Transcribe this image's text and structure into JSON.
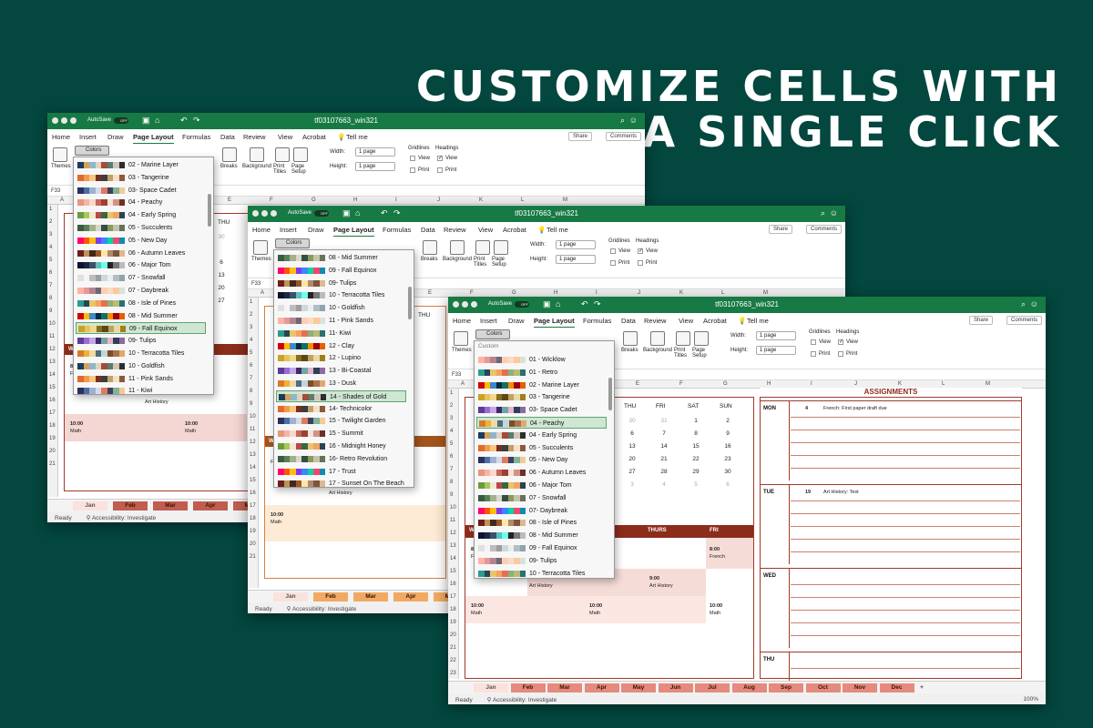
{
  "headline": {
    "line1": "CUSTOMIZE CELLS WITH",
    "line2": "A SINGLE CLICK"
  },
  "app": {
    "autosave": "AutoSave",
    "toggle": "OFF",
    "filename": "tf03107663_win321",
    "menu": [
      "Home",
      "Insert",
      "Draw",
      "Page Layout",
      "Formulas",
      "Data",
      "Review",
      "View",
      "Acrobat"
    ],
    "tell_me": "Tell me",
    "share": "Share",
    "comments": "Comments",
    "ribbon": {
      "themes": "Themes",
      "colors": "Colors",
      "breaks": "Breaks",
      "background": "Background",
      "print_titles": "Print Titles",
      "page_setup": "Page Setup",
      "width_label": "Width:",
      "height_label": "Height:",
      "width_value": "1 page",
      "height_value": "1 page",
      "gridlines": "Gridlines",
      "headings": "Headings",
      "view": "View",
      "print": "Print"
    },
    "status_ready": "Ready",
    "status_access": "Accessibility: Investigate",
    "zoom": "100%"
  },
  "window1": {
    "cell_ref": "F33",
    "columns": [
      "A",
      "B",
      "C",
      "D",
      "E",
      "F",
      "G",
      "H",
      "I",
      "J",
      "K",
      "L",
      "M"
    ],
    "rows": [
      "1",
      "2",
      "3",
      "4",
      "5",
      "6",
      "7",
      "8",
      "9",
      "10",
      "11",
      "12",
      "13",
      "14",
      "15",
      "16",
      "17",
      "18",
      "19",
      "20",
      "21"
    ],
    "dropdown": [
      "02 - Marine Layer",
      "03 - Tangerine",
      "03- Space Cadet",
      "04 - Peachy",
      "04 - Early Spring",
      "05 - Succulents",
      "05 - New Day",
      "06 - Autumn Leaves",
      "06 - Major Tom",
      "07 - Snowfall",
      "07 - Daybreak",
      "08 - Isle of Pines",
      "08 - Mid Summer",
      "09 - Fall Equinox",
      "09- Tulips",
      "10 - Terracotta Tiles",
      "10 - Goldfish",
      "11 - Pink Sands",
      "11 - Kiwi"
    ],
    "selected": "09 - Fall Equinox",
    "peek": {
      "thu": "THU",
      "n30": "30",
      "n6": "6",
      "n13": "13",
      "n20": "20",
      "n27": "27",
      "we": "WE",
      "t8": "8:",
      "fr": "Fr"
    },
    "cells": {
      "art": "Art History",
      "t10a": "10:00",
      "math": "Math",
      "t10b": "10:00",
      "math2": "Math"
    },
    "tabs": [
      "Jan",
      "Feb",
      "Mar",
      "Apr",
      "May"
    ]
  },
  "window2": {
    "cell_ref": "F33",
    "columns": [
      "A",
      "B",
      "C",
      "D",
      "E",
      "F",
      "G",
      "H",
      "I",
      "J",
      "K",
      "L",
      "M"
    ],
    "rows": [
      "1",
      "2",
      "3",
      "4",
      "5",
      "6",
      "7",
      "8",
      "9",
      "10",
      "11",
      "12",
      "13",
      "14",
      "15",
      "16",
      "17",
      "18",
      "19",
      "20",
      "21"
    ],
    "dropdown": [
      "08 - Mid Summer",
      "09 - Fall Equinox",
      "09- Tulips",
      "10 - Terracotta Tiles",
      "10 - Goldfish",
      "11 - Pink Sands",
      "11- Kiwi",
      "12 - Clay",
      "12 - Lupino",
      "13 - Bi-Coastal",
      "13 - Dusk",
      "14 - Shades of Gold",
      "14- Technicolor",
      "15 - Twilight Garden",
      "15 - Summit",
      "16 - Midnight Honey",
      "16- Retro Revolution",
      "17 - Trust",
      "17 - Sunset On The Beach"
    ],
    "selected": "14 - Shades of Gold",
    "peek": {
      "thu": "THU",
      "we": "WE",
      "fr": "Fr"
    },
    "cells": {
      "art": "Art History",
      "t10": "10:00",
      "math": "Math"
    },
    "tabs": [
      "Jan",
      "Feb",
      "Mar",
      "Apr",
      "May"
    ]
  },
  "window3": {
    "cell_ref": "F33",
    "columns": [
      "A",
      "B",
      "C",
      "D",
      "E",
      "F",
      "G",
      "H",
      "I",
      "J",
      "K",
      "L",
      "M"
    ],
    "rows": [
      "1",
      "2",
      "3",
      "4",
      "5",
      "6",
      "7",
      "8",
      "9",
      "10",
      "11",
      "12",
      "13",
      "14",
      "15",
      "16",
      "17",
      "18",
      "19",
      "20",
      "21",
      "22",
      "23",
      "24"
    ],
    "dropdown_header": "Custom",
    "dropdown": [
      "01 - Wicklow",
      "01 - Retro",
      "02 - Marine Layer",
      "03 - Tangerine",
      "03- Space Cadet",
      "04 - Peachy",
      "04 - Early Spring",
      "05 - Succulents",
      "05 - New Day",
      "06 - Autumn Leaves",
      "06 - Major Tom",
      "07 - Snowfall",
      "07- Daybreak",
      "08 - Isle of Pines",
      "08 - Mid Summer",
      "09 - Fall Equinox",
      "09- Tulips",
      "10 - Terracotta Tiles"
    ],
    "selected": "04 - Peachy",
    "calendar": {
      "headers": [
        "THU",
        "FRI",
        "SAT",
        "SUN"
      ],
      "weeks": [
        [
          "30",
          "31",
          "1",
          "2"
        ],
        [
          "6",
          "7",
          "8",
          "9"
        ],
        [
          "13",
          "14",
          "15",
          "16"
        ],
        [
          "20",
          "21",
          "22",
          "23"
        ],
        [
          "27",
          "28",
          "29",
          "30"
        ],
        [
          "3",
          "4",
          "5",
          "6"
        ]
      ]
    },
    "week_header": [
      "THURS",
      "FRI"
    ],
    "we": "WE",
    "cells": {
      "t8_left": "8:",
      "fr_left": "Fr",
      "t8": "8:00",
      "french": "French",
      "t9": "9:00",
      "art_hist": "Art History",
      "art_hist2": "Art History",
      "t10a": "10:00",
      "math_a": "Math",
      "t10b": "10:00",
      "math_b": "Math",
      "t10c": "10:00",
      "math_c": "Math"
    },
    "assignments": {
      "title": "ASSIGNMENTS",
      "days": [
        "MON",
        "TUE",
        "WED",
        "THU"
      ],
      "entries": [
        {
          "num": "4",
          "text": "French: First paper draft due"
        },
        {
          "num": "19",
          "text": "Art History: Test"
        }
      ]
    },
    "tabs": [
      "Jan",
      "Feb",
      "Mar",
      "Apr",
      "May",
      "Jun",
      "Jul",
      "Aug",
      "Sep",
      "Oct",
      "Nov",
      "Dec"
    ],
    "add_tab": "+"
  },
  "palettes": {
    "p1": [
      "#1f3b5a",
      "#d6a15b",
      "#8fb6c9",
      "#e1d3c1",
      "#a34b3a",
      "#5a7d6e",
      "#cfc8b8",
      "#2d2d2d"
    ],
    "p2": [
      "#e26a2c",
      "#f29b4b",
      "#f7c680",
      "#7a2e1f",
      "#3d3d3d",
      "#c1a06b",
      "#f5e0c3",
      "#8b5a3c"
    ],
    "p3": [
      "#2b2f5a",
      "#4a6fa5",
      "#9fb1d1",
      "#d4dbe8",
      "#e07a5f",
      "#3d405b",
      "#81b29a",
      "#f2cc8f"
    ],
    "p4": [
      "#e9967a",
      "#f4b6a5",
      "#fbd8cc",
      "#c7665a",
      "#9c3f34",
      "#f7e1d7",
      "#d39384",
      "#6d2f27"
    ],
    "p5": [
      "#6a9c3f",
      "#a7c957",
      "#f2e8cf",
      "#bc4749",
      "#386641",
      "#e9c46a",
      "#f4a261",
      "#264653"
    ],
    "p6": [
      "#3a5a40",
      "#588157",
      "#a3b18a",
      "#dad7cd",
      "#344e41",
      "#8a9a5b",
      "#c2c5aa",
      "#6b705c"
    ],
    "p7": [
      "#ff006e",
      "#fb5607",
      "#ffbe0b",
      "#8338ec",
      "#3a86ff",
      "#06d6a0",
      "#ef476f",
      "#118ab2"
    ],
    "p8": [
      "#6f1d1b",
      "#bb9457",
      "#432818",
      "#99582a",
      "#ffe6a7",
      "#b08968",
      "#7f5539",
      "#ddb892"
    ],
    "p9": [
      "#0b132b",
      "#1c2541",
      "#3a506b",
      "#5bc0be",
      "#6fffe9",
      "#222",
      "#777",
      "#bbb"
    ],
    "p10": [
      "#e0e0e0",
      "#f5f5f5",
      "#bdbdbd",
      "#9e9e9e",
      "#cfd8dc",
      "#eceff1",
      "#b0bec5",
      "#90a4ae"
    ],
    "p11": [
      "#ffb4a2",
      "#e5989b",
      "#b5838d",
      "#6d6875",
      "#ffcdb2",
      "#f9dcc4",
      "#fec89a",
      "#d8e2dc"
    ],
    "p12": [
      "#2a9d8f",
      "#264653",
      "#e9c46a",
      "#f4a261",
      "#e76f51",
      "#8ab17d",
      "#babb74",
      "#287271"
    ],
    "p13": [
      "#d00000",
      "#ffba08",
      "#3f88c5",
      "#032b43",
      "#136f63",
      "#f48c06",
      "#9d0208",
      "#e85d04"
    ],
    "p14": [
      "#c9a227",
      "#e6c35c",
      "#f0d98c",
      "#8a6d1d",
      "#5c4813",
      "#bfa35f",
      "#e9d8a6",
      "#a47e1b"
    ],
    "p15": [
      "#5d3a9b",
      "#9a6bd1",
      "#c4a7e7",
      "#3f2a6e",
      "#6fa8a0",
      "#e6b3cc",
      "#2e4057",
      "#8d6a9f"
    ],
    "p16": [
      "#d97a2b",
      "#f2b134",
      "#efd9a7",
      "#4f6d7a",
      "#c0d6df",
      "#7d4e24",
      "#a8744f",
      "#e3a869"
    ]
  }
}
